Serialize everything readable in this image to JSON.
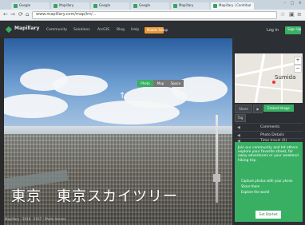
{
  "browser": {
    "tabs": [
      {
        "label": "Google"
      },
      {
        "label": "Mapillary"
      },
      {
        "label": "Google"
      },
      {
        "label": "Google"
      },
      {
        "label": "Mapillary"
      },
      {
        "label": "Mapillary | Contribute"
      }
    ],
    "url": "www.mapillary.com/map/im/...",
    "window_controls": "– □ ×"
  },
  "site_nav": {
    "brand": "Mapillary",
    "links": [
      "Community",
      "Solutions",
      "ArcGIS",
      "Blog",
      "Help"
    ],
    "highlight_button": "Mobile Setup",
    "login": "Log in",
    "signup": "Sign Up"
  },
  "viewer": {
    "modes": [
      "Photo",
      "Map",
      "Space"
    ],
    "direction_arrow": "↑",
    "caption": "東京　東京スカイツリー",
    "attribution": "Mapillary · 2016 · 2017 · Photo license"
  },
  "sidebar": {
    "map_label": "Sumida",
    "controls": {
      "left": "Share",
      "play": "▶",
      "green": "Embed Image",
      "small": "Tag"
    },
    "panels": [
      {
        "icon": "◀",
        "label": "Comments"
      },
      {
        "icon": "◀",
        "label": "Photo Details"
      },
      {
        "icon": "◀",
        "label": "Time travel (0)"
      }
    ],
    "promo": {
      "headline": "Join our community and let others explore your favorite street, far away adventures or your weekend hiking trip.",
      "bullets": [
        "Capture photos with your phone",
        "Share them",
        "Explore the world"
      ],
      "cta": "Get Started"
    }
  },
  "colors": {
    "accent": "#39af64",
    "nav_bg": "#2c2f33",
    "orange": "#e8993a"
  }
}
